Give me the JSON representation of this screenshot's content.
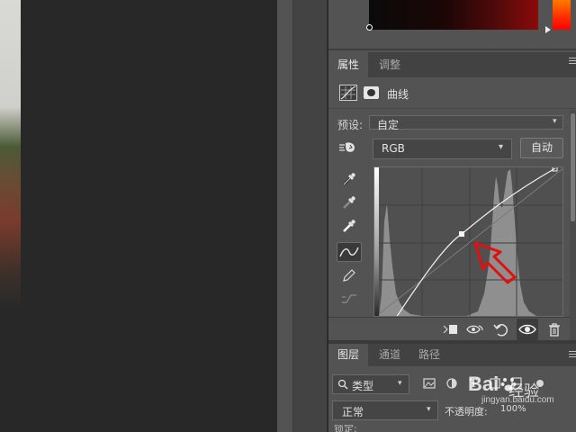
{
  "properties_panel": {
    "tabs": [
      "属性",
      "调整"
    ],
    "adjustment_name": "曲线",
    "preset_label": "预设:",
    "preset_value": "自定",
    "channel_value": "RGB",
    "auto_button_label": "自动"
  },
  "layers_panel": {
    "tabs": [
      "图层",
      "通道",
      "路径"
    ],
    "filter_value": "类型",
    "blend_mode": "正常",
    "opacity_label": "不透明度:",
    "opacity_value": "100%",
    "lock_label": "锁定:"
  },
  "watermark": {
    "brand": "Bai",
    "brand_cn": "经验",
    "url": "jingyan.baidu.com"
  },
  "colors": {
    "accent_arrow": "#e01010",
    "panel_bg": "#535353",
    "canvas_bg": "#282828"
  },
  "icons": [
    "target-adjust-icon",
    "eyedropper-black-icon",
    "eyedropper-gray-icon",
    "eyedropper-white-icon",
    "curve-point-icon",
    "pencil-icon",
    "smooth-icon",
    "clip-to-layer-icon",
    "view-previous-icon",
    "reset-icon",
    "visibility-eye-icon",
    "trash-icon",
    "search-icon",
    "image-filter-icon",
    "adjustment-filter-icon",
    "type-filter-icon",
    "shape-filter-icon",
    "smart-object-filter-icon"
  ]
}
